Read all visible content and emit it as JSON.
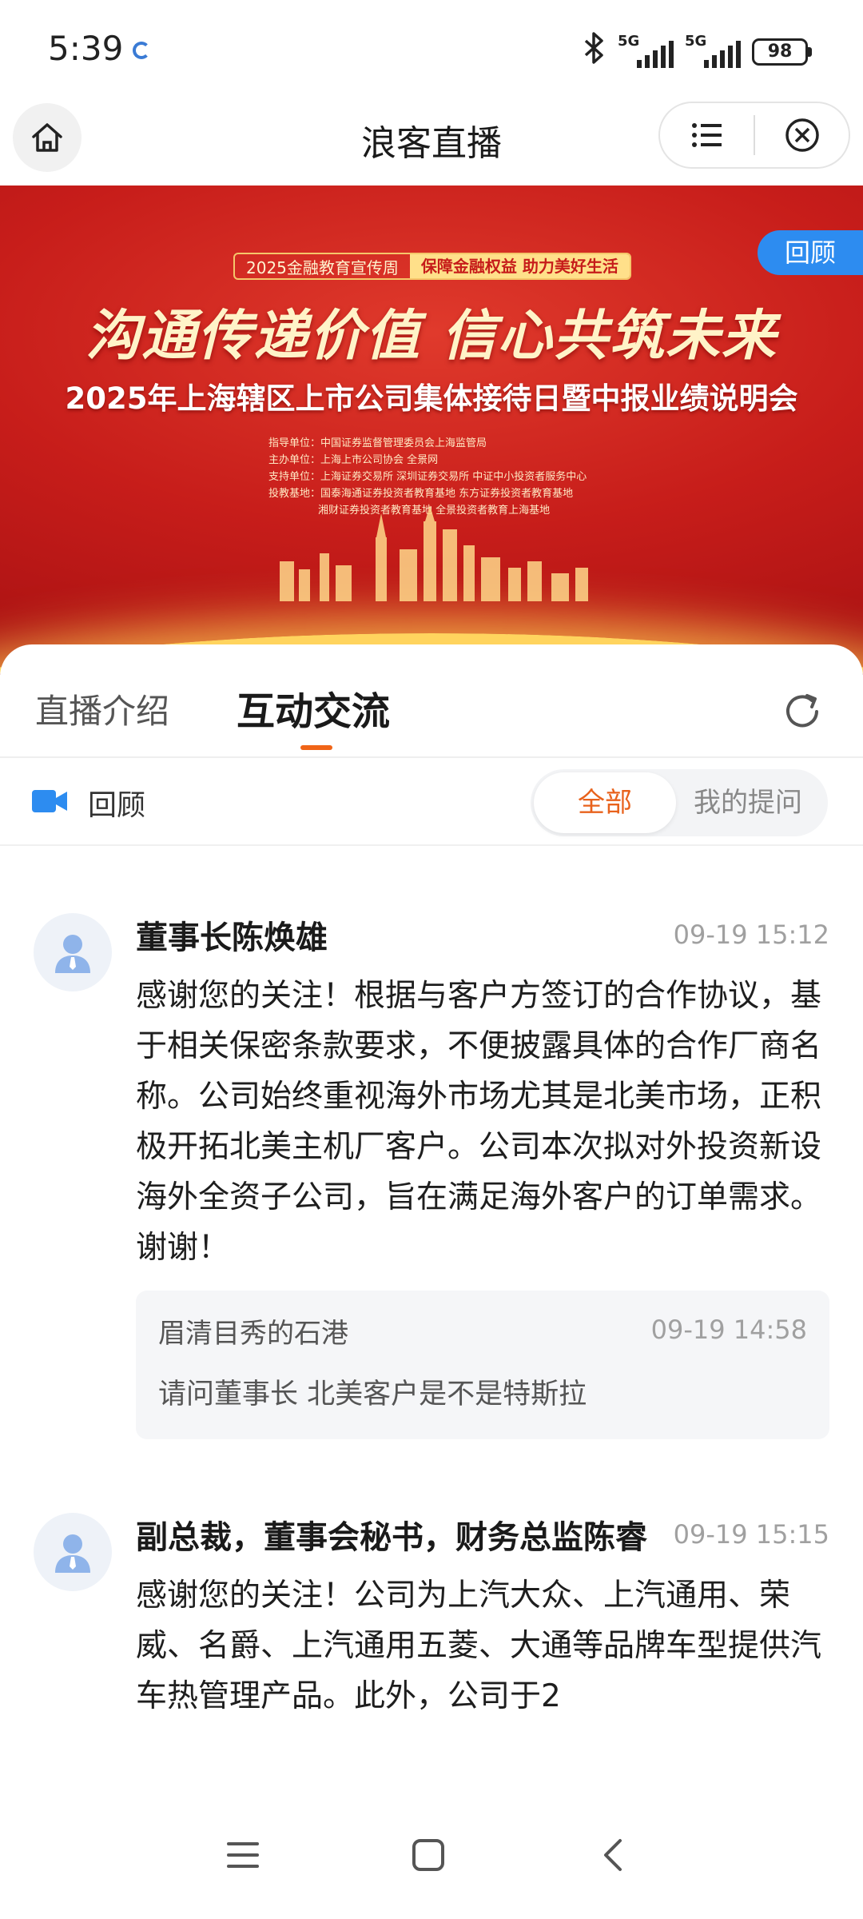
{
  "status_bar": {
    "time": "5:39",
    "network1": "5G",
    "network2": "5G",
    "battery": "98"
  },
  "nav": {
    "title": "浪客直播"
  },
  "banner": {
    "tagline_left": "2025金融教育宣传周",
    "tagline_right": "保障金融权益 助力美好生活",
    "slogan": "沟通传递价值 信心共筑未来",
    "headline": "2025年上海辖区上市公司集体接待日暨中报业绩说明会",
    "info_lines": [
      "指导单位：中国证券监督管理委员会上海监管局",
      "主办单位：上海上市公司协会  全景网",
      "支持单位：上海证券交易所  深圳证券交易所  中证中小投资者服务中心",
      "投教基地：国泰海通证券投资者教育基地  东方证券投资者教育基地",
      "湘财证券投资者教育基地  全景投资者教育上海基地"
    ],
    "badge": "回顾"
  },
  "tabs": {
    "intro": "直播介绍",
    "interact": "互动交流"
  },
  "filter": {
    "replay": "回顾",
    "all": "全部",
    "mine": "我的提问"
  },
  "posts": [
    {
      "name": "董事长陈焕雄",
      "time": "09-19 15:12",
      "content": "感谢您的关注！根据与客户方签订的合作协议，基于相关保密条款要求，不便披露具体的合作厂商名称。公司始终重视海外市场尤其是北美市场，正积极开拓北美主机厂客户。公司本次拟对外投资新设海外全资子公司，旨在满足海外客户的订单需求。谢谢！",
      "quote": {
        "name": "眉清目秀的石港",
        "time": "09-19 14:58",
        "text": "请问董事长 北美客户是不是特斯拉"
      }
    },
    {
      "name": "副总裁，董事会秘书，财务总监陈睿",
      "time": "09-19 15:15",
      "content": "感谢您的关注！公司为上汽大众、上汽通用、荣威、名爵、上汽通用五菱、大通等品牌车型提供汽车热管理产品。此外，公司于2"
    }
  ]
}
